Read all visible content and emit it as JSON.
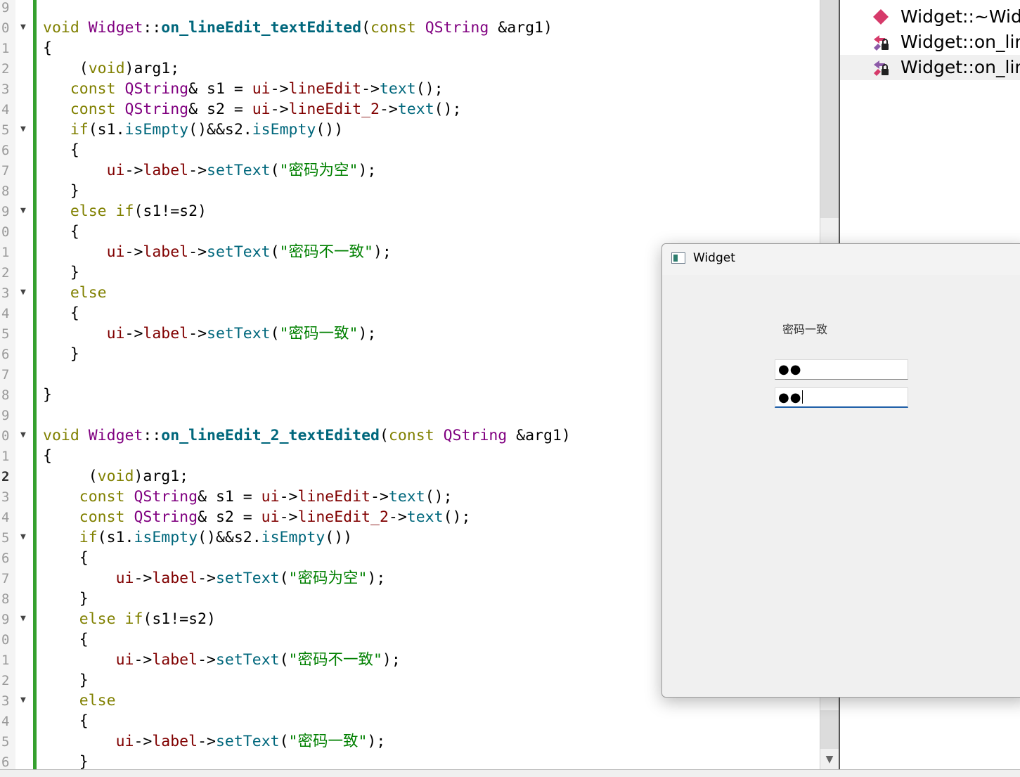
{
  "editor": {
    "line_numbers": [
      "9",
      "0",
      "1",
      "2",
      "3",
      "4",
      "5",
      "6",
      "7",
      "8",
      "9",
      "0",
      "1",
      "2",
      "3",
      "4",
      "5",
      "6",
      "7",
      "8",
      "9",
      "0",
      "1",
      "2",
      "3",
      "4",
      "5",
      "6",
      "7",
      "8",
      "9",
      "0",
      "1",
      "2",
      "3",
      "4",
      "5",
      "6"
    ],
    "current_line_number": "2",
    "lines": [
      {
        "indent": 0,
        "tokens": []
      },
      {
        "indent": 0,
        "tokens": [
          {
            "c": "kw",
            "t": "void "
          },
          {
            "c": "ty",
            "t": "Widget"
          },
          {
            "c": "",
            "t": "::"
          },
          {
            "c": "fn",
            "t": "on_lineEdit_textEdited"
          },
          {
            "c": "",
            "t": "("
          },
          {
            "c": "kw",
            "t": "const "
          },
          {
            "c": "ty",
            "t": "QString"
          },
          {
            "c": "",
            "t": " &arg1)"
          }
        ]
      },
      {
        "indent": 0,
        "tokens": [
          {
            "c": "",
            "t": "{"
          }
        ]
      },
      {
        "indent": 0,
        "tokens": [
          {
            "c": "",
            "t": "    ("
          },
          {
            "c": "kw",
            "t": "void"
          },
          {
            "c": "",
            "t": ")arg1;"
          }
        ]
      },
      {
        "indent": 0,
        "tokens": [
          {
            "c": "",
            "t": "   "
          },
          {
            "c": "kw",
            "t": "const "
          },
          {
            "c": "ty",
            "t": "QString"
          },
          {
            "c": "",
            "t": "& s1 = "
          },
          {
            "c": "mb",
            "t": "ui"
          },
          {
            "c": "",
            "t": "->"
          },
          {
            "c": "mb",
            "t": "lineEdit"
          },
          {
            "c": "",
            "t": "->"
          },
          {
            "c": "mt",
            "t": "text"
          },
          {
            "c": "",
            "t": "();"
          }
        ]
      },
      {
        "indent": 0,
        "tokens": [
          {
            "c": "",
            "t": "   "
          },
          {
            "c": "kw",
            "t": "const "
          },
          {
            "c": "ty",
            "t": "QString"
          },
          {
            "c": "",
            "t": "& s2 = "
          },
          {
            "c": "mb",
            "t": "ui"
          },
          {
            "c": "",
            "t": "->"
          },
          {
            "c": "mb",
            "t": "lineEdit_2"
          },
          {
            "c": "",
            "t": "->"
          },
          {
            "c": "mt",
            "t": "text"
          },
          {
            "c": "",
            "t": "();"
          }
        ]
      },
      {
        "indent": 0,
        "tokens": [
          {
            "c": "",
            "t": "   "
          },
          {
            "c": "kw",
            "t": "if"
          },
          {
            "c": "",
            "t": "(s1."
          },
          {
            "c": "mt",
            "t": "isEmpty"
          },
          {
            "c": "",
            "t": "()&&s2."
          },
          {
            "c": "mt",
            "t": "isEmpty"
          },
          {
            "c": "",
            "t": "())"
          }
        ]
      },
      {
        "indent": 0,
        "tokens": [
          {
            "c": "",
            "t": "   {"
          }
        ]
      },
      {
        "indent": 0,
        "tokens": [
          {
            "c": "",
            "t": "       "
          },
          {
            "c": "mb",
            "t": "ui"
          },
          {
            "c": "",
            "t": "->"
          },
          {
            "c": "mb",
            "t": "label"
          },
          {
            "c": "",
            "t": "->"
          },
          {
            "c": "mt",
            "t": "setText"
          },
          {
            "c": "",
            "t": "("
          },
          {
            "c": "st",
            "t": "\"密码为空\""
          },
          {
            "c": "",
            "t": ");"
          }
        ]
      },
      {
        "indent": 0,
        "tokens": [
          {
            "c": "",
            "t": "   }"
          }
        ]
      },
      {
        "indent": 0,
        "tokens": [
          {
            "c": "",
            "t": "   "
          },
          {
            "c": "kw",
            "t": "else if"
          },
          {
            "c": "",
            "t": "(s1!=s2)"
          }
        ]
      },
      {
        "indent": 0,
        "tokens": [
          {
            "c": "",
            "t": "   {"
          }
        ]
      },
      {
        "indent": 0,
        "tokens": [
          {
            "c": "",
            "t": "       "
          },
          {
            "c": "mb",
            "t": "ui"
          },
          {
            "c": "",
            "t": "->"
          },
          {
            "c": "mb",
            "t": "label"
          },
          {
            "c": "",
            "t": "->"
          },
          {
            "c": "mt",
            "t": "setText"
          },
          {
            "c": "",
            "t": "("
          },
          {
            "c": "st",
            "t": "\"密码不一致\""
          },
          {
            "c": "",
            "t": ");"
          }
        ]
      },
      {
        "indent": 0,
        "tokens": [
          {
            "c": "",
            "t": "   }"
          }
        ]
      },
      {
        "indent": 0,
        "tokens": [
          {
            "c": "",
            "t": "   "
          },
          {
            "c": "kw",
            "t": "else"
          }
        ]
      },
      {
        "indent": 0,
        "tokens": [
          {
            "c": "",
            "t": "   {"
          }
        ]
      },
      {
        "indent": 0,
        "tokens": [
          {
            "c": "",
            "t": "       "
          },
          {
            "c": "mb",
            "t": "ui"
          },
          {
            "c": "",
            "t": "->"
          },
          {
            "c": "mb",
            "t": "label"
          },
          {
            "c": "",
            "t": "->"
          },
          {
            "c": "mt",
            "t": "setText"
          },
          {
            "c": "",
            "t": "("
          },
          {
            "c": "st",
            "t": "\"密码一致\""
          },
          {
            "c": "",
            "t": ");"
          }
        ]
      },
      {
        "indent": 0,
        "tokens": [
          {
            "c": "",
            "t": "   }"
          }
        ]
      },
      {
        "indent": 0,
        "tokens": []
      },
      {
        "indent": 0,
        "tokens": [
          {
            "c": "",
            "t": "}"
          }
        ]
      },
      {
        "indent": 0,
        "tokens": []
      },
      {
        "indent": 0,
        "tokens": [
          {
            "c": "kw",
            "t": "void "
          },
          {
            "c": "ty",
            "t": "Widget"
          },
          {
            "c": "",
            "t": "::"
          },
          {
            "c": "fn",
            "t": "on_lineEdit_2_textEdited"
          },
          {
            "c": "",
            "t": "("
          },
          {
            "c": "kw",
            "t": "const "
          },
          {
            "c": "ty",
            "t": "QString"
          },
          {
            "c": "",
            "t": " &arg1)"
          }
        ]
      },
      {
        "indent": 0,
        "tokens": [
          {
            "c": "",
            "t": "{"
          }
        ]
      },
      {
        "indent": 0,
        "tokens": [
          {
            "c": "",
            "t": "     ("
          },
          {
            "c": "kw",
            "t": "void"
          },
          {
            "c": "",
            "t": ")arg1;"
          }
        ]
      },
      {
        "indent": 0,
        "tokens": [
          {
            "c": "",
            "t": "    "
          },
          {
            "c": "kw",
            "t": "const "
          },
          {
            "c": "ty",
            "t": "QString"
          },
          {
            "c": "",
            "t": "& s1 = "
          },
          {
            "c": "mb",
            "t": "ui"
          },
          {
            "c": "",
            "t": "->"
          },
          {
            "c": "mb",
            "t": "lineEdit"
          },
          {
            "c": "",
            "t": "->"
          },
          {
            "c": "mt",
            "t": "text"
          },
          {
            "c": "",
            "t": "();"
          }
        ]
      },
      {
        "indent": 0,
        "tokens": [
          {
            "c": "",
            "t": "    "
          },
          {
            "c": "kw",
            "t": "const "
          },
          {
            "c": "ty",
            "t": "QString"
          },
          {
            "c": "",
            "t": "& s2 = "
          },
          {
            "c": "mb",
            "t": "ui"
          },
          {
            "c": "",
            "t": "->"
          },
          {
            "c": "mb",
            "t": "lineEdit_2"
          },
          {
            "c": "",
            "t": "->"
          },
          {
            "c": "mt",
            "t": "text"
          },
          {
            "c": "",
            "t": "();"
          }
        ]
      },
      {
        "indent": 0,
        "tokens": [
          {
            "c": "",
            "t": "    "
          },
          {
            "c": "kw",
            "t": "if"
          },
          {
            "c": "",
            "t": "(s1."
          },
          {
            "c": "mt",
            "t": "isEmpty"
          },
          {
            "c": "",
            "t": "()&&s2."
          },
          {
            "c": "mt",
            "t": "isEmpty"
          },
          {
            "c": "",
            "t": "())"
          }
        ]
      },
      {
        "indent": 0,
        "tokens": [
          {
            "c": "",
            "t": "    {"
          }
        ]
      },
      {
        "indent": 0,
        "tokens": [
          {
            "c": "",
            "t": "        "
          },
          {
            "c": "mb",
            "t": "ui"
          },
          {
            "c": "",
            "t": "->"
          },
          {
            "c": "mb",
            "t": "label"
          },
          {
            "c": "",
            "t": "->"
          },
          {
            "c": "mt",
            "t": "setText"
          },
          {
            "c": "",
            "t": "("
          },
          {
            "c": "st",
            "t": "\"密码为空\""
          },
          {
            "c": "",
            "t": ");"
          }
        ]
      },
      {
        "indent": 0,
        "tokens": [
          {
            "c": "",
            "t": "    }"
          }
        ]
      },
      {
        "indent": 0,
        "tokens": [
          {
            "c": "",
            "t": "    "
          },
          {
            "c": "kw",
            "t": "else if"
          },
          {
            "c": "",
            "t": "(s1!=s2)"
          }
        ]
      },
      {
        "indent": 0,
        "tokens": [
          {
            "c": "",
            "t": "    {"
          }
        ]
      },
      {
        "indent": 0,
        "tokens": [
          {
            "c": "",
            "t": "        "
          },
          {
            "c": "mb",
            "t": "ui"
          },
          {
            "c": "",
            "t": "->"
          },
          {
            "c": "mb",
            "t": "label"
          },
          {
            "c": "",
            "t": "->"
          },
          {
            "c": "mt",
            "t": "setText"
          },
          {
            "c": "",
            "t": "("
          },
          {
            "c": "st",
            "t": "\"密码不一致\""
          },
          {
            "c": "",
            "t": ");"
          }
        ]
      },
      {
        "indent": 0,
        "tokens": [
          {
            "c": "",
            "t": "    }"
          }
        ]
      },
      {
        "indent": 0,
        "tokens": [
          {
            "c": "",
            "t": "    "
          },
          {
            "c": "kw",
            "t": "else"
          }
        ]
      },
      {
        "indent": 0,
        "tokens": [
          {
            "c": "",
            "t": "    {"
          }
        ]
      },
      {
        "indent": 0,
        "tokens": [
          {
            "c": "",
            "t": "        "
          },
          {
            "c": "mb",
            "t": "ui"
          },
          {
            "c": "",
            "t": "->"
          },
          {
            "c": "mb",
            "t": "label"
          },
          {
            "c": "",
            "t": "->"
          },
          {
            "c": "mt",
            "t": "setText"
          },
          {
            "c": "",
            "t": "("
          },
          {
            "c": "st",
            "t": "\"密码一致\""
          },
          {
            "c": "",
            "t": ");"
          }
        ]
      },
      {
        "indent": 0,
        "tokens": [
          {
            "c": "",
            "t": "    }"
          }
        ]
      }
    ],
    "fold_markers_on_lines": [
      1,
      6,
      10,
      14,
      21,
      26,
      30,
      34
    ]
  },
  "outline": {
    "items": [
      {
        "label": "Widget::~Widg",
        "icon": "destructor-method-icon",
        "selected": false
      },
      {
        "label": "Widget::on_line",
        "icon": "private-slot-icon",
        "selected": false
      },
      {
        "label": "Widget::on_line",
        "icon": "private-slot-icon",
        "selected": true
      }
    ]
  },
  "popup": {
    "title": "Widget",
    "label_text": "密码一致",
    "password1_value": "●●",
    "password2_value": "●●"
  },
  "colors": {
    "keyword": "#808000",
    "type": "#800080",
    "function": "#00677c",
    "string": "#008000",
    "member": "#800000",
    "change_bar": "#35a02e",
    "focus_underline": "#1f5fa8"
  }
}
